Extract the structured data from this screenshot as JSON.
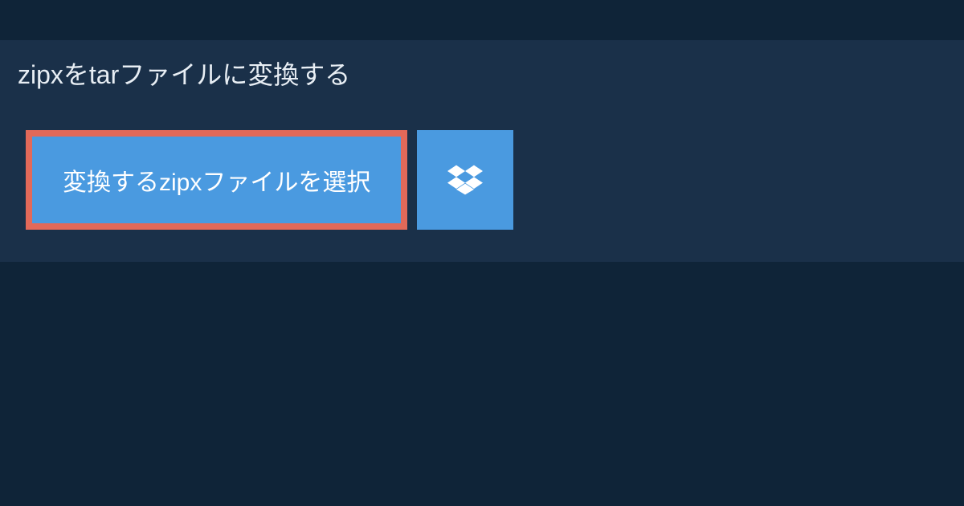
{
  "header": {
    "title": "zipxをtarファイルに変換する"
  },
  "actions": {
    "select_file_label": "変換するzipxファイルを選択"
  }
}
